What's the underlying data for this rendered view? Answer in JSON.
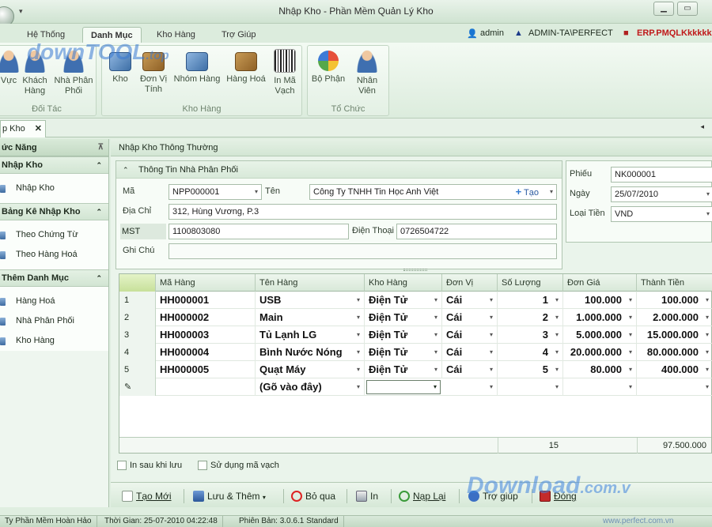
{
  "window": {
    "title": "Nhập Kho - Phần Mềm Quản Lý Kho",
    "qat_arrow": "▾",
    "minimize": "▁",
    "restore": "▭"
  },
  "ribbon_tabs": [
    "Hệ Thống",
    "Danh Mục",
    "Kho Hàng",
    "Trợ Giúp"
  ],
  "user": {
    "name": "admin",
    "server": "ADMIN-TA\\PERFECT",
    "database": "ERP.PMQLKkkkkk"
  },
  "ribbon": {
    "doi_tac": {
      "label": "Đối Tác",
      "buttons": [
        "Vực",
        "Khách Hàng",
        "Nhà Phân Phối"
      ]
    },
    "kho_hang": {
      "label": "Kho Hàng",
      "buttons": [
        "Kho",
        "Đơn Vị Tính",
        "Nhóm Hàng",
        "Hàng Hoá",
        "In Mã Vạch"
      ]
    },
    "to_chuc": {
      "label": "Tổ Chức",
      "buttons": [
        "Bộ Phận",
        "Nhân Viên"
      ]
    }
  },
  "watermarks": {
    "top_main": "downTOOL",
    "top_small": ".top",
    "bottom_main": "Download",
    "bottom_small": ".com.v",
    "bottom_url": "www.perfect.com.vn"
  },
  "doc_tab": {
    "label": "p Kho",
    "close": "✕"
  },
  "nav": {
    "header": "ức Năng",
    "pin": "⊼",
    "chevron": "⌃",
    "groups": [
      {
        "title": "Nhập Kho",
        "items": [
          "Nhập Kho"
        ]
      },
      {
        "title": "Bảng Kê Nhập Kho",
        "items": [
          "Theo Chứng Từ",
          "Theo Hàng Hoá"
        ]
      },
      {
        "title": "Thêm Danh Mục",
        "items": [
          "Hàng Hoá",
          "Nhà Phân Phối",
          "Kho Hàng"
        ]
      }
    ]
  },
  "main": {
    "title": "Nhập Kho Thông Thường",
    "supplier_title": "Thông Tin Nhà Phân Phối",
    "chevron": "⌃",
    "dd": "▾",
    "fields": {
      "ma_label": "Mã",
      "ma_value": "NPP000001",
      "ten_label": "Tên",
      "ten_value": "Công Ty TNHH Tin Học Anh Việt",
      "add_plus": "+",
      "add_label": "Tạo",
      "diachi_label": "Địa Chỉ",
      "diachi_value": "312, Hùng Vương, P.3",
      "mst_label": "MST",
      "mst_value": "1100803080",
      "dienthoai_label": "Điện Thoại",
      "dienthoai_value": "0726504722",
      "ghichu_label": "Ghi Chú",
      "ghichu_value": ""
    },
    "receipt": {
      "phieu_label": "Phiếu",
      "phieu_value": "NK000001",
      "ngay_label": "Ngày",
      "ngay_value": "25/07/2010",
      "loaitien_label": "Loại Tiền",
      "loaitien_value": "VND"
    }
  },
  "grid": {
    "columns": [
      "Mã Hàng",
      "Tên Hàng",
      "Kho Hàng",
      "Đơn Vị",
      "Số Lượng",
      "Đơn Giá",
      "Thành Tiền"
    ],
    "rows": [
      {
        "no": "1",
        "ma": "HH000001",
        "ten": "USB",
        "kho": "Điện Tử",
        "dv": "Cái",
        "sl": "1",
        "dg": "100.000",
        "tt": "100.000"
      },
      {
        "no": "2",
        "ma": "HH000002",
        "ten": "Main",
        "kho": "Điện Tử",
        "dv": "Cái",
        "sl": "2",
        "dg": "1.000.000",
        "tt": "2.000.000"
      },
      {
        "no": "3",
        "ma": "HH000003",
        "ten": "Tủ Lạnh LG",
        "kho": "Điện Tử",
        "dv": "Cái",
        "sl": "3",
        "dg": "5.000.000",
        "tt": "15.000.000"
      },
      {
        "no": "4",
        "ma": "HH000004",
        "ten": "Bình Nước Nóng",
        "kho": "Điện Tử",
        "dv": "Cái",
        "sl": "4",
        "dg": "20.000.000",
        "tt": "80.000.000"
      },
      {
        "no": "5",
        "ma": "HH000005",
        "ten": "Quạt Máy",
        "kho": "Điện Tử",
        "dv": "Cái",
        "sl": "5",
        "dg": "80.000",
        "tt": "400.000"
      }
    ],
    "new_row": {
      "marker": "✎",
      "placeholder": "(Gõ vào đây)"
    },
    "footer": {
      "total_qty": "15",
      "total_amount": "97.500.000"
    }
  },
  "options": {
    "print_after_save": "In sau khi lưu",
    "use_barcode": "Sử dụng mã vạch"
  },
  "toolbar": {
    "new": "Tạo Mới",
    "save_add": "Lưu & Thêm",
    "save_add_arrow": "▾",
    "skip": "Bỏ qua",
    "print": "In",
    "reload": "Nạp Lại",
    "help": "Trợ giúp",
    "close": "Đóng"
  },
  "statusbar": {
    "company": "Ty Phần Mềm Hoàn Hảo",
    "time": "Thời Gian: 25-07-2010 04:22:48",
    "version": "Phiên Bản: 3.0.6.1 Standard"
  }
}
